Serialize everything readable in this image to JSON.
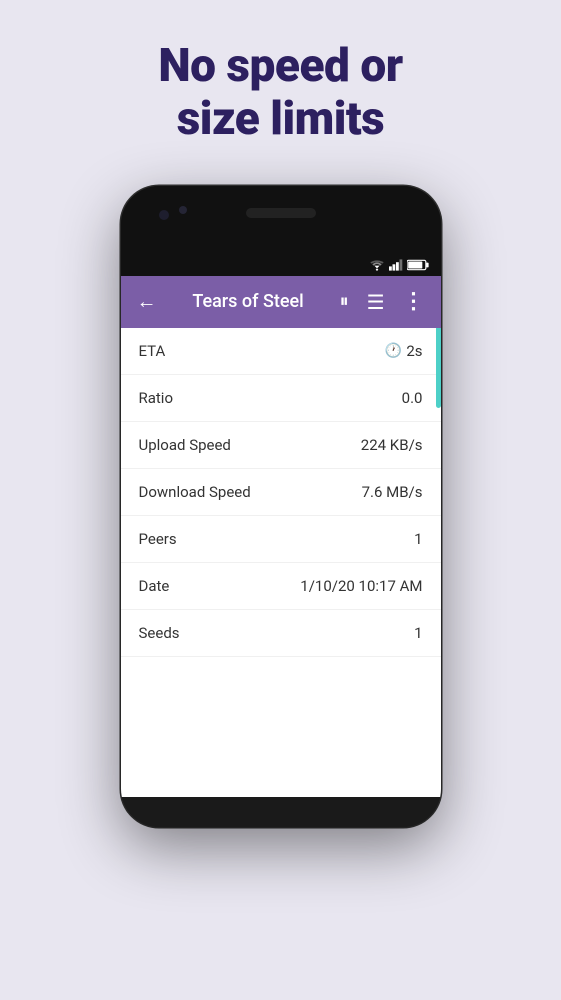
{
  "page": {
    "background_color": "#e8e6f0",
    "headline": "No speed or\nsize limits"
  },
  "toolbar": {
    "title": "Tears of Steel",
    "back_label": "←",
    "pause_label": "⏸",
    "list_label": "☰",
    "more_label": "⋮",
    "background_color": "#7b5ea7"
  },
  "stats": {
    "rows": [
      {
        "label": "ETA",
        "value": "2s",
        "has_clock": true
      },
      {
        "label": "Ratio",
        "value": "0.0",
        "has_clock": false
      },
      {
        "label": "Upload Speed",
        "value": "224 KB/s",
        "has_clock": false
      },
      {
        "label": "Download Speed",
        "value": "7.6 MB/s",
        "has_clock": false
      },
      {
        "label": "Peers",
        "value": "1",
        "has_clock": false
      },
      {
        "label": "Date",
        "value": "1/10/20 10:17 AM",
        "has_clock": false
      },
      {
        "label": "Seeds",
        "value": "1",
        "has_clock": false
      }
    ]
  }
}
